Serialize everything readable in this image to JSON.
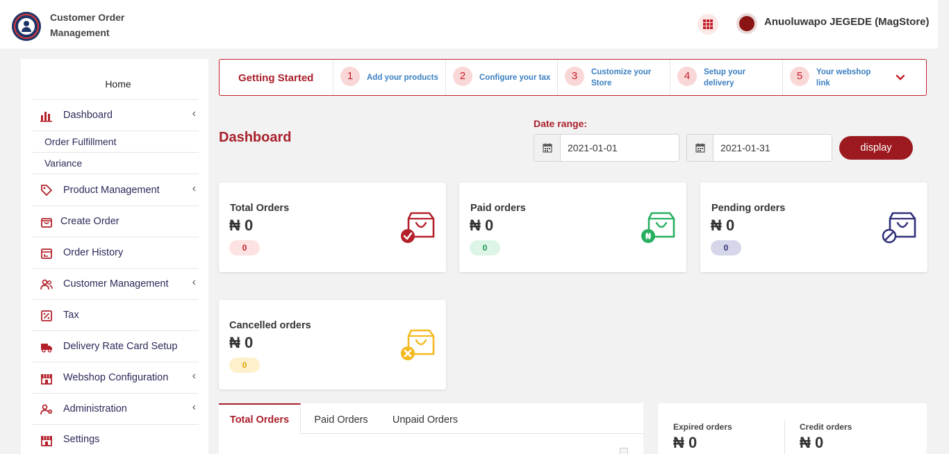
{
  "header": {
    "app_title": "Customer Order Management",
    "user_name": "Anuoluwapo JEGEDE (MagStore)"
  },
  "sidebar": {
    "home": "Home",
    "items": [
      {
        "label": "Dashboard",
        "icon": "bar-chart-icon",
        "has_submenu": true
      },
      {
        "label": "Order Fulfillment",
        "sub": true
      },
      {
        "label": "Variance",
        "sub": true
      },
      {
        "label": "Product Management",
        "icon": "tag-icon",
        "has_submenu": true
      },
      {
        "label": "Create Order",
        "icon": "bag-icon",
        "has_submenu": false
      },
      {
        "label": "Order History",
        "icon": "calendar-icon",
        "has_submenu": false
      },
      {
        "label": "Customer Management",
        "icon": "users-icon",
        "has_submenu": true
      },
      {
        "label": "Tax",
        "icon": "percent-icon",
        "has_submenu": false
      },
      {
        "label": "Delivery Rate Card Setup",
        "icon": "truck-icon",
        "has_submenu": false
      },
      {
        "label": "Webshop Configuration",
        "icon": "store-icon",
        "has_submenu": true
      },
      {
        "label": "Administration",
        "icon": "user-gear-icon",
        "has_submenu": true
      },
      {
        "label": "Settings",
        "icon": "store-icon",
        "has_submenu": false
      }
    ]
  },
  "getting_started": {
    "title": "Getting Started",
    "steps": [
      {
        "num": "1",
        "label": "Add your products"
      },
      {
        "num": "2",
        "label": "Configure your tax"
      },
      {
        "num": "3",
        "label": "Customize your Store"
      },
      {
        "num": "4",
        "label": "Setup your delivery"
      },
      {
        "num": "5",
        "label": "Your webshop link"
      }
    ]
  },
  "dashboard": {
    "title": "Dashboard",
    "date_range_label": "Date range:",
    "date_from": "2021-01-01",
    "date_to": "2021-01-31",
    "display_label": "display"
  },
  "cards": [
    {
      "title": "Total Orders",
      "value": "₦ 0",
      "badge": "0",
      "color": "#b3202a",
      "badge_bg": "#fde2e2",
      "badge_color": "#c41f2a",
      "icon": "bag-check-icon"
    },
    {
      "title": "Paid orders",
      "value": "₦ 0",
      "badge": "0",
      "color": "#27ae60",
      "badge_bg": "#dcf5e6",
      "badge_color": "#1e9a4e",
      "icon": "bag-naira-icon"
    },
    {
      "title": "Pending orders",
      "value": "₦ 0",
      "badge": "0",
      "color": "#2e2e78",
      "badge_bg": "#d6d6ea",
      "badge_color": "#2e2e78",
      "icon": "bag-blocked-icon"
    },
    {
      "title": "Cancelled orders",
      "value": "₦ 0",
      "badge": "0",
      "color": "#f4b921",
      "badge_bg": "#fdf0cc",
      "badge_color": "#e3a400",
      "icon": "bag-cancel-icon"
    }
  ],
  "tabs": [
    {
      "label": "Total Orders",
      "active": true
    },
    {
      "label": "Paid Orders",
      "active": false
    },
    {
      "label": "Unpaid Orders",
      "active": false
    }
  ],
  "extra_stats": [
    {
      "title": "Expired orders",
      "value": "₦ 0"
    },
    {
      "title": "Credit orders",
      "value": "₦ 0"
    }
  ],
  "colors": {
    "accent": "#a91f2a",
    "link": "#3a7fc1",
    "nav_text": "#2a2a5a"
  }
}
